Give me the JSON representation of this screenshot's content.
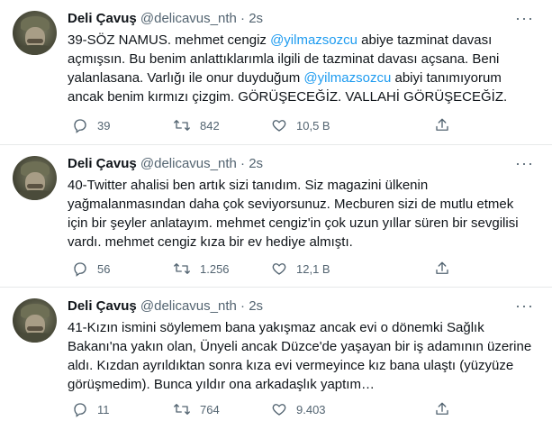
{
  "tweets": [
    {
      "name": "Deli Çavuş",
      "handle": "@delicavus_nth",
      "dot": "·",
      "time": "2s",
      "text_parts": [
        "39-SÖZ NAMUS. mehmet cengiz ",
        "@yilmazsozcu",
        " abiye tazminat davası açmışsın. Bu benim anlattıklarımla ilgili de tazminat davası açsana. Beni yalanlasana. Varlığı ile onur duyduğum ",
        "@yilmazsozcu",
        " abiyi tanımıyorum ancak benim kırmızı çizgim. GÖRÜŞECEĞİZ. VALLAHİ GÖRÜŞECEĞİZ."
      ],
      "replies": "39",
      "retweets": "842",
      "likes": "10,5 B"
    },
    {
      "name": "Deli Çavuş",
      "handle": "@delicavus_nth",
      "dot": "·",
      "time": "2s",
      "text": "40-Twitter ahalisi ben artık sizi tanıdım. Siz magazini ülkenin yağmalanmasından daha çok seviyorsunuz. Mecburen sizi de mutlu etmek için bir şeyler anlatayım. mehmet cengiz'in çok uzun yıllar süren bir sevgilisi vardı. mehmet cengiz kıza bir ev hediye almıştı.",
      "replies": "56",
      "retweets": "1.256",
      "likes": "12,1 B"
    },
    {
      "name": "Deli Çavuş",
      "handle": "@delicavus_nth",
      "dot": "·",
      "time": "2s",
      "text": "41-Kızın ismini söylemem bana yakışmaz ancak evi o dönemki Sağlık Bakanı'na yakın olan, Ünyeli ancak Düzce'de yaşayan bir iş adamının üzerine aldı. Kızdan ayrıldıktan sonra kıza evi vermeyince kız bana ulaştı (yüzyüze görüşmedim). Bunca yıldır ona arkadaşlık yaptım…",
      "replies": "11",
      "retweets": "764",
      "likes": "9.403"
    }
  ],
  "icons": {
    "reply": "reply-icon",
    "retweet": "retweet-icon",
    "like": "like-icon",
    "share": "share-icon",
    "more": "more-icon"
  },
  "colors": {
    "mention": "#1d9bf0",
    "secondary_text": "#536471",
    "separator": "#e7e9ea"
  }
}
